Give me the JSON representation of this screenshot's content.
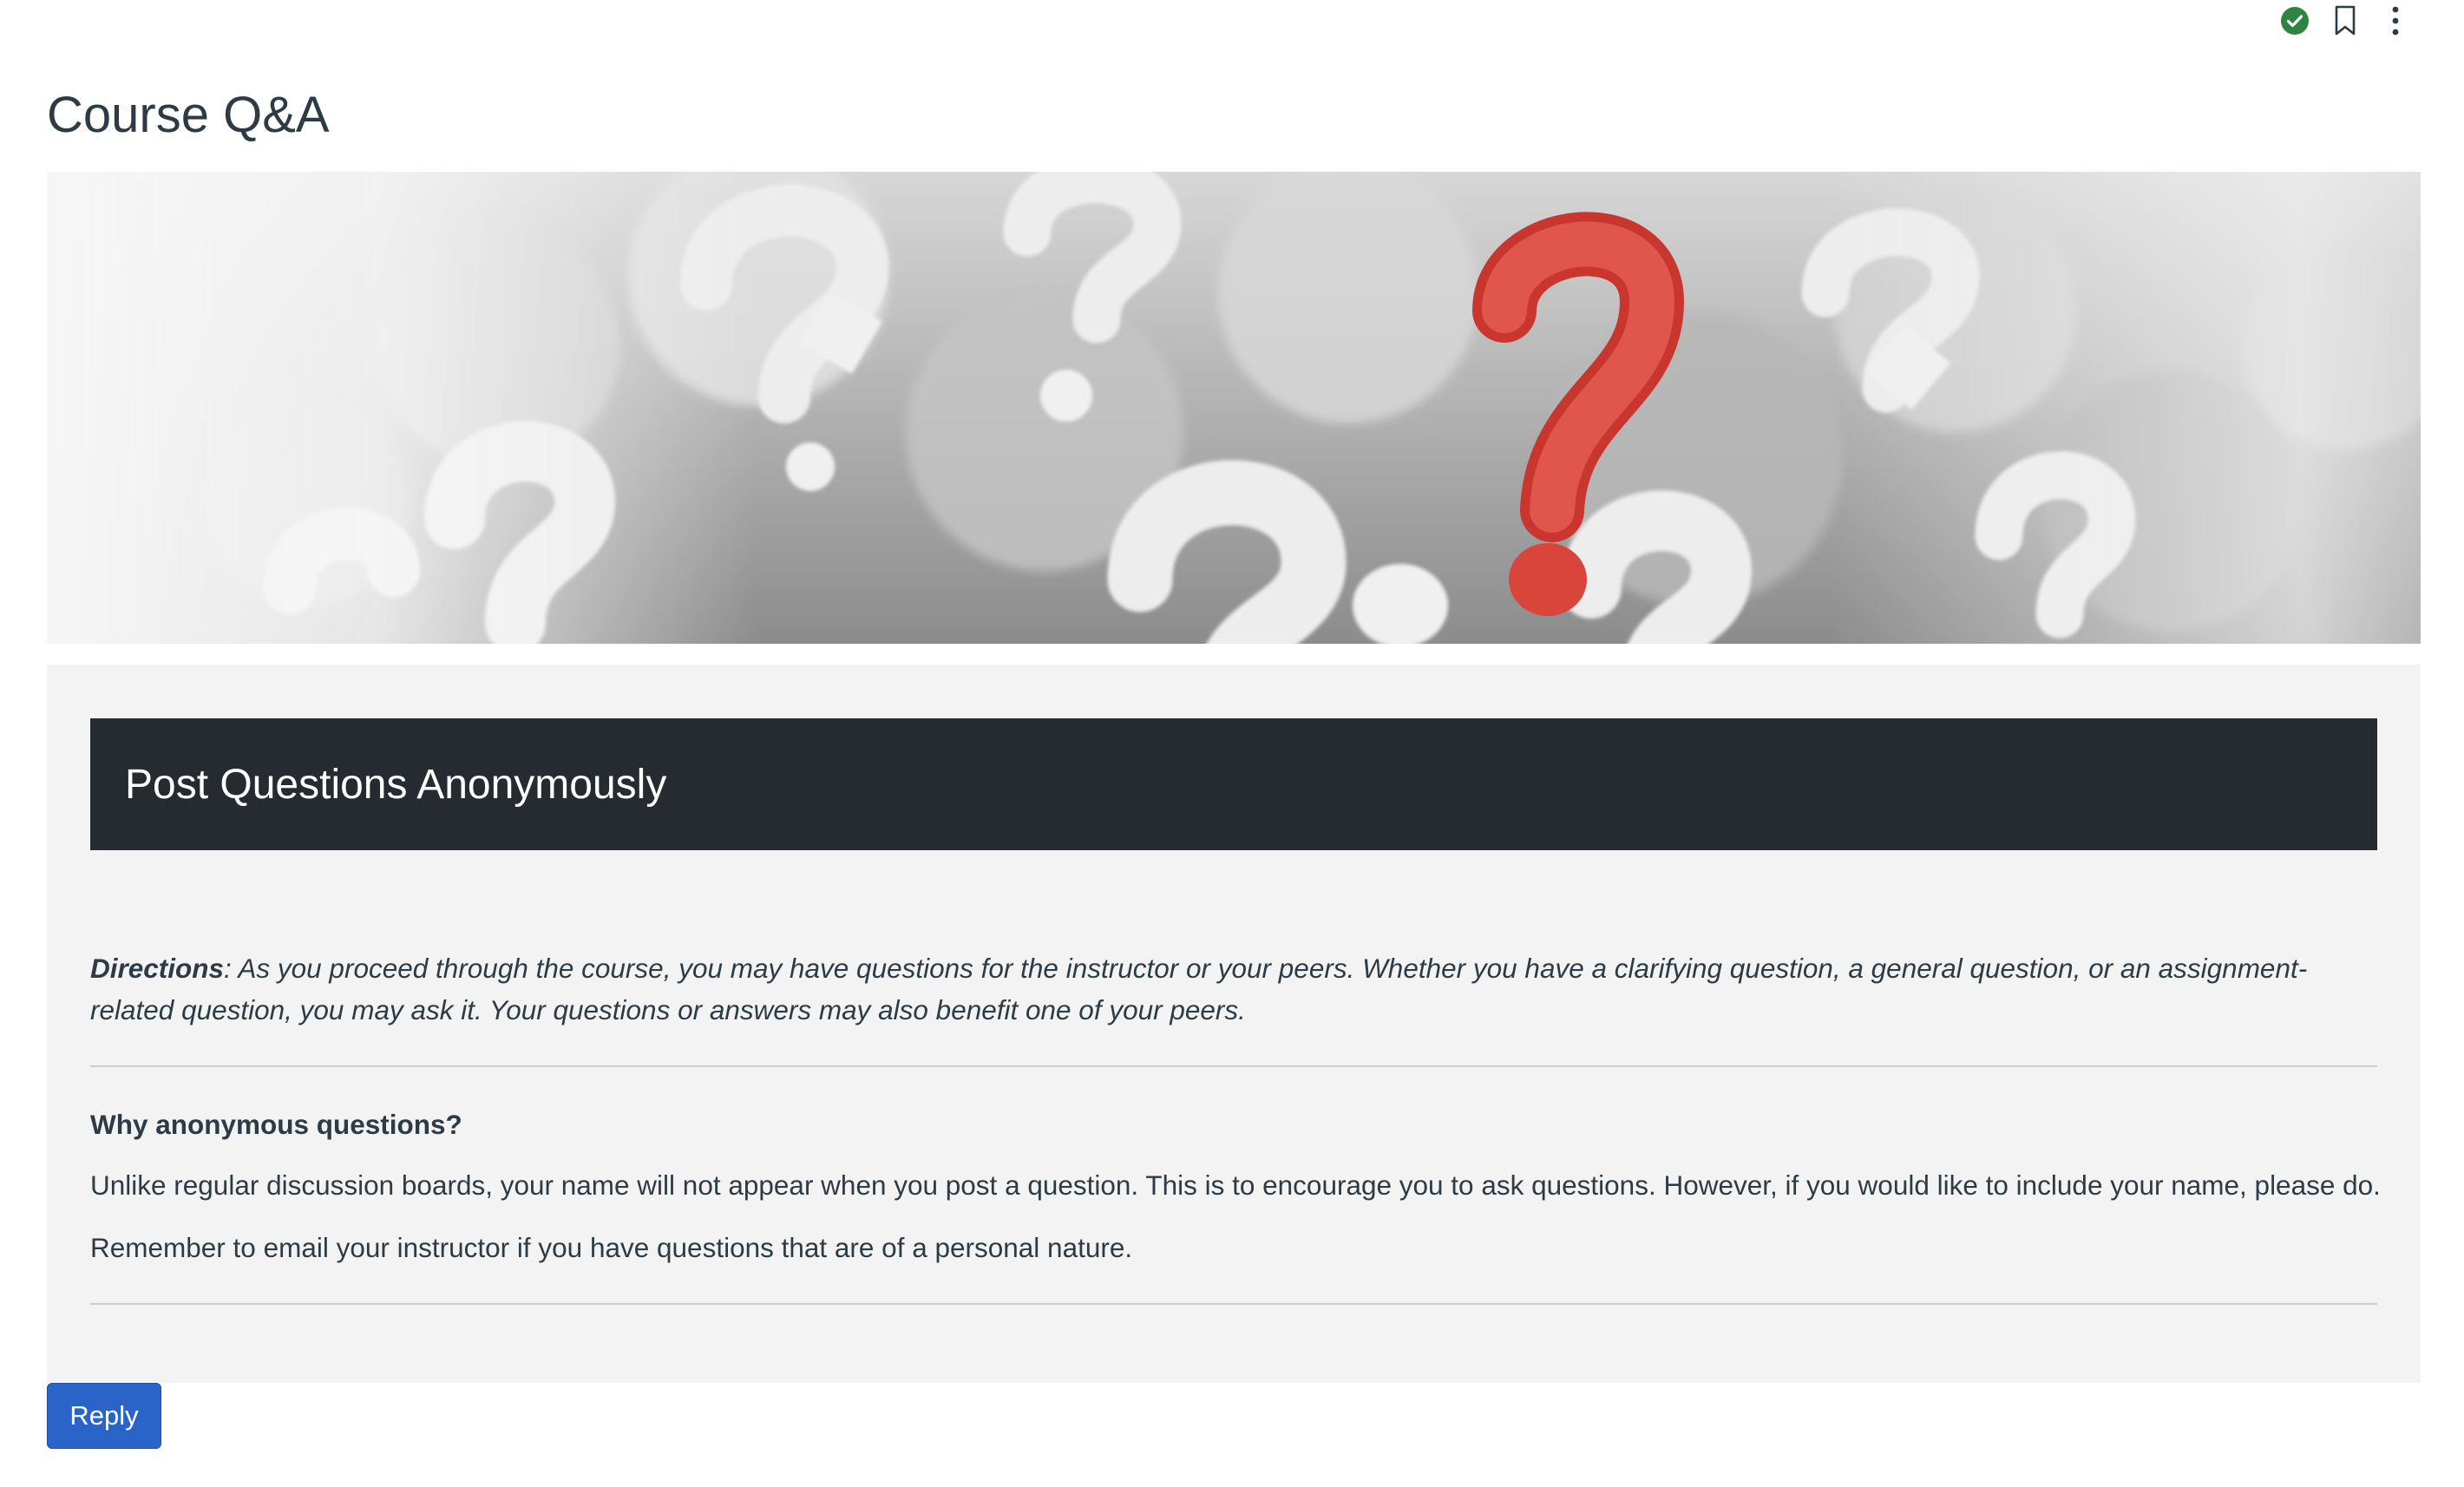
{
  "toolbar": {
    "published_icon": "check-circle-icon",
    "bookmark_icon": "bookmark-icon",
    "options_icon": "kebab-menu-icon",
    "status_color": "#2e8540"
  },
  "page": {
    "title": "Course Q&A"
  },
  "banner": {
    "image_subject": "question-marks-banner",
    "accent_color": "#d9453b"
  },
  "section": {
    "header": "Post Questions Anonymously",
    "header_bg": "#262a31",
    "directions_label": "Directions",
    "directions_text": ": As you proceed through the course, you may have questions for the instructor or your peers. Whether you have a clarifying question, a general question, or an assignment-related question, you may ask it. Your questions or answers may also benefit one of your peers.",
    "why_heading": "Why anonymous questions?",
    "why_paragraph": "Unlike regular discussion boards, your name will not appear when you post a question. This is to encourage you to ask questions. However, if you would like to include your name, please do.",
    "reminder": "Remember to email your instructor if you have questions that are of a personal nature."
  },
  "actions": {
    "reply_label": "Reply",
    "reply_color": "#2b64c8"
  }
}
